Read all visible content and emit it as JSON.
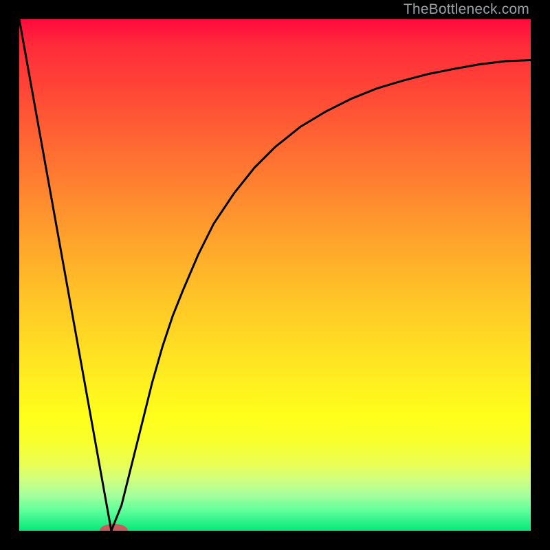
{
  "watermark": "TheBottleneck.com",
  "colors": {
    "curve_stroke": "#000000",
    "oval_fill": "#c75c5c"
  },
  "chart_data": {
    "type": "line",
    "title": "",
    "xlabel": "",
    "ylabel": "",
    "xlim": [
      0,
      100
    ],
    "ylim": [
      0,
      100
    ],
    "grid": false,
    "legend": false,
    "series": [
      {
        "name": "left-leg",
        "x": [
          0,
          18
        ],
        "y": [
          100,
          0
        ]
      },
      {
        "name": "right-curve",
        "x": [
          18,
          20,
          22,
          24,
          26,
          28,
          30,
          32,
          35,
          38,
          42,
          46,
          50,
          55,
          60,
          65,
          70,
          75,
          80,
          85,
          90,
          95,
          100
        ],
        "y": [
          0,
          5,
          13,
          21,
          29,
          36,
          42,
          47,
          54,
          60,
          66,
          71,
          75,
          79,
          82,
          84.5,
          86.5,
          88,
          89.3,
          90.3,
          91.2,
          91.8,
          92
        ]
      }
    ],
    "marker": {
      "name": "bottleneck-point",
      "x": 18.5,
      "y": 0,
      "rx": 2.8,
      "ry": 1.3
    }
  }
}
